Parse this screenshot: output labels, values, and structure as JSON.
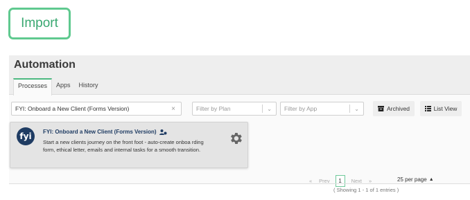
{
  "import_button": {
    "label": "Import"
  },
  "header": {
    "title": "Automation"
  },
  "tabs": [
    {
      "label": "Processes",
      "active": true
    },
    {
      "label": "Apps",
      "active": false
    },
    {
      "label": "History",
      "active": false
    }
  ],
  "filters": {
    "search_value": "FYI: Onboard a New Client (Forms Version)",
    "clear_icon": "×",
    "plan_placeholder": "Filter by Plan",
    "app_placeholder": "Filter by App"
  },
  "toolbar": {
    "archived_label": "Archived",
    "list_view_label": "List View"
  },
  "process_card": {
    "logo_text": "fyi",
    "title": "FYI: Onboard a New Client (Forms Version)",
    "description": "Start a new clients journey on the front foot - auto-create onboa rding form, ethical letter, emails and internal tasks for a smooth transition."
  },
  "pagination": {
    "first": "«",
    "prev": "Prev",
    "current_page": "1",
    "next": "Next",
    "last": "»",
    "per_page": "25 per page",
    "showing": "( Showing 1 - 1 of 1 entries )"
  },
  "colors": {
    "accent_green": "#4cb880",
    "fyi_navy": "#1f3c63"
  }
}
